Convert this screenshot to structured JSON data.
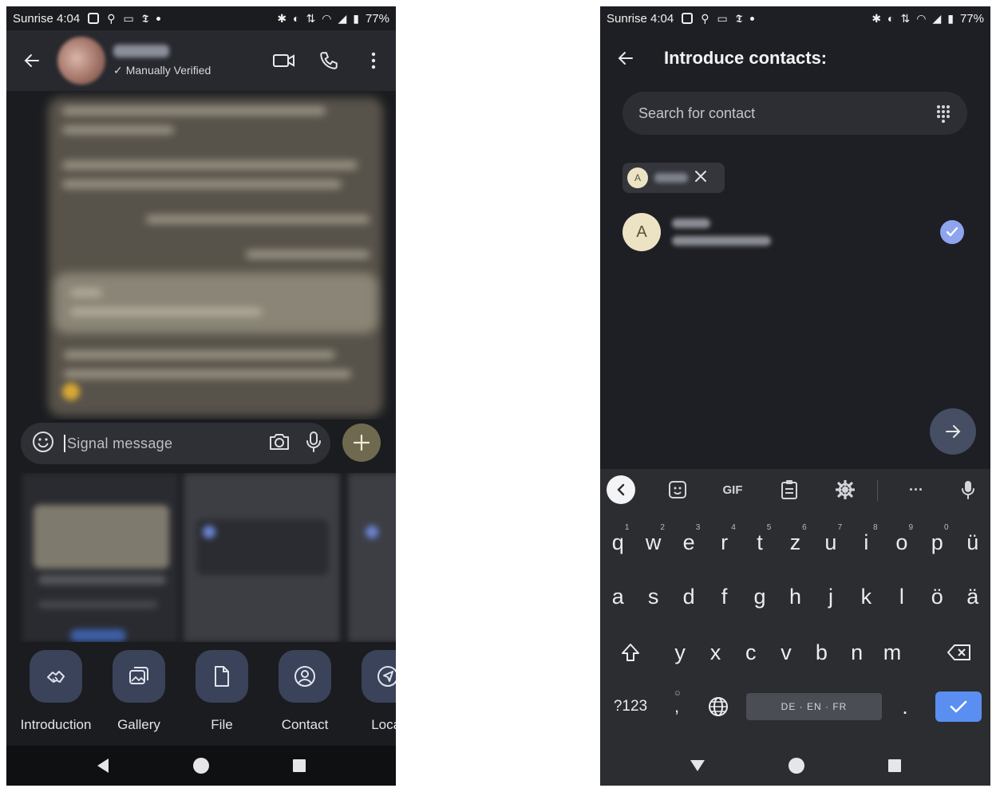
{
  "status_bar": {
    "carrier_time": "Sunrise 4:04",
    "battery": "77%"
  },
  "chat": {
    "verified_label": "Manually Verified",
    "composer_placeholder": "Signal message"
  },
  "attach_tray": {
    "items": [
      {
        "label": "Introduction",
        "icon": "introduction-icon"
      },
      {
        "label": "Gallery",
        "icon": "gallery-icon"
      },
      {
        "label": "File",
        "icon": "file-icon"
      },
      {
        "label": "Contact",
        "icon": "contact-icon"
      },
      {
        "label": "Locat",
        "icon": "location-icon"
      }
    ]
  },
  "introduce": {
    "title": "Introduce contacts:",
    "search_placeholder": "Search for contact",
    "chip_avatar_letter": "A",
    "contact_avatar_letter": "A"
  },
  "keyboard": {
    "toolbar_gif": "GIF",
    "toolbar_more": "···",
    "row1": [
      {
        "key": "q",
        "hint": "1"
      },
      {
        "key": "w",
        "hint": "2"
      },
      {
        "key": "e",
        "hint": "3"
      },
      {
        "key": "r",
        "hint": "4"
      },
      {
        "key": "t",
        "hint": "5"
      },
      {
        "key": "z",
        "hint": "6"
      },
      {
        "key": "u",
        "hint": "7"
      },
      {
        "key": "i",
        "hint": "8"
      },
      {
        "key": "o",
        "hint": "9"
      },
      {
        "key": "p",
        "hint": "0"
      },
      {
        "key": "ü",
        "hint": ""
      }
    ],
    "row2": [
      "a",
      "s",
      "d",
      "f",
      "g",
      "h",
      "j",
      "k",
      "l",
      "ö",
      "ä"
    ],
    "row3": [
      "y",
      "x",
      "c",
      "v",
      "b",
      "n",
      "m"
    ],
    "symbols_key": "?123",
    "comma_key": ",",
    "period_key": ".",
    "space_label": "DE · EN · FR"
  },
  "colors": {
    "accent_check": "#8fa4ef",
    "enter_key": "#5a8ff1",
    "plus_button": "#6f6a4f",
    "tray_button": "#3a4359"
  }
}
